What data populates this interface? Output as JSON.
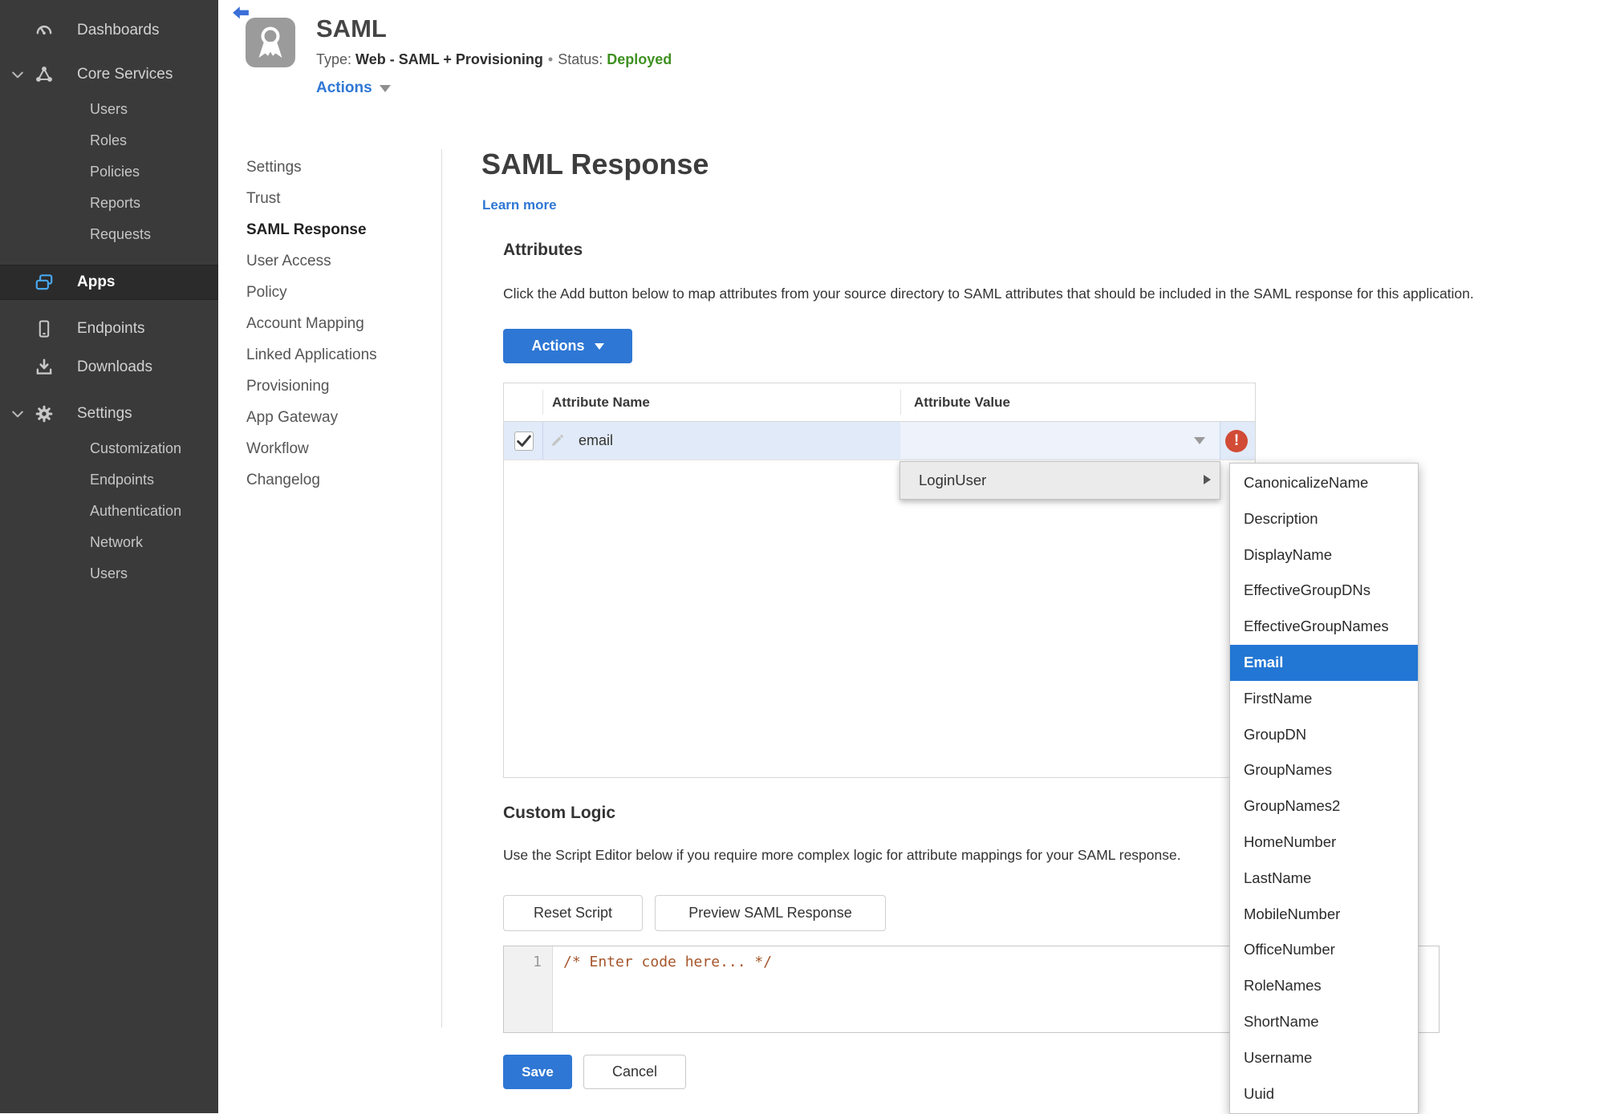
{
  "sidebar": {
    "items": [
      {
        "label": "Dashboards",
        "icon": "gauge-icon",
        "type": "top",
        "gap": ""
      },
      {
        "label": "Core Services",
        "icon": "core-services-icon",
        "type": "top",
        "expanded": true,
        "gap": "gap7"
      },
      {
        "label": "Users",
        "type": "child"
      },
      {
        "label": "Roles",
        "type": "child"
      },
      {
        "label": "Policies",
        "type": "child"
      },
      {
        "label": "Reports",
        "type": "child"
      },
      {
        "label": "Requests",
        "type": "child"
      },
      {
        "label": "Apps",
        "icon": "apps-icon",
        "type": "top",
        "active": true,
        "gap": "gap18"
      },
      {
        "label": "Endpoints",
        "icon": "phone-icon",
        "type": "top",
        "gap": "gap12"
      },
      {
        "label": "Downloads",
        "icon": "download-icon",
        "type": "top"
      },
      {
        "label": "Settings",
        "icon": "gear-icon",
        "type": "top",
        "expanded": true,
        "gap": "gap10"
      },
      {
        "label": "Customization",
        "type": "child"
      },
      {
        "label": "Endpoints",
        "type": "child"
      },
      {
        "label": "Authentication",
        "type": "child"
      },
      {
        "label": "Network",
        "type": "child"
      },
      {
        "label": "Users",
        "type": "child"
      }
    ]
  },
  "header": {
    "title": "SAML",
    "type_label": "Type:",
    "type_value": "Web - SAML + Provisioning",
    "separator": "•",
    "status_label": "Status:",
    "status_value": "Deployed",
    "actions_label": "Actions"
  },
  "subnav": {
    "items": [
      {
        "label": "Settings"
      },
      {
        "label": "Trust"
      },
      {
        "label": "SAML Response",
        "active": true
      },
      {
        "label": "User Access"
      },
      {
        "label": "Policy"
      },
      {
        "label": "Account Mapping"
      },
      {
        "label": "Linked Applications"
      },
      {
        "label": "Provisioning"
      },
      {
        "label": "App Gateway"
      },
      {
        "label": "Workflow"
      },
      {
        "label": "Changelog"
      }
    ]
  },
  "main": {
    "title": "SAML Response",
    "learn_more": "Learn more",
    "attributes": {
      "heading": "Attributes",
      "description": "Click the Add button below to map attributes from your source directory to SAML attributes that should be included in the SAML response for this application.",
      "actions_button": "Actions",
      "table": {
        "columns": [
          "Attribute Name",
          "Attribute Value"
        ],
        "rows": [
          {
            "name": "email",
            "value": "",
            "checked": true,
            "error": true
          }
        ]
      }
    },
    "custom_logic": {
      "heading": "Custom Logic",
      "description": "Use the Script Editor below if you require more complex logic for attribute mappings for your SAML response.",
      "reset_button": "Reset Script",
      "preview_button": "Preview SAML Response",
      "editor": {
        "line_number": "1",
        "code": "/* Enter code here... */"
      }
    },
    "save_button": "Save",
    "cancel_button": "Cancel"
  },
  "dropdown": {
    "label": "LoginUser"
  },
  "submenu": {
    "selected": "Email",
    "items": [
      "CanonicalizeName",
      "Description",
      "DisplayName",
      "EffectiveGroupDNs",
      "EffectiveGroupNames",
      "Email",
      "FirstName",
      "GroupDN",
      "GroupNames",
      "GroupNames2",
      "HomeNumber",
      "LastName",
      "MobileNumber",
      "OfficeNumber",
      "RoleNames",
      "ShortName",
      "Username",
      "Uuid"
    ]
  },
  "colors": {
    "accent_blue": "#2e77d4",
    "status_green": "#3f9122",
    "error_red": "#d14b36",
    "selected_row": "#e1eaf8",
    "menu_selected": "#2277d4",
    "sidebar_bg": "#3a3a3a",
    "code_comment": "#a5562b"
  }
}
